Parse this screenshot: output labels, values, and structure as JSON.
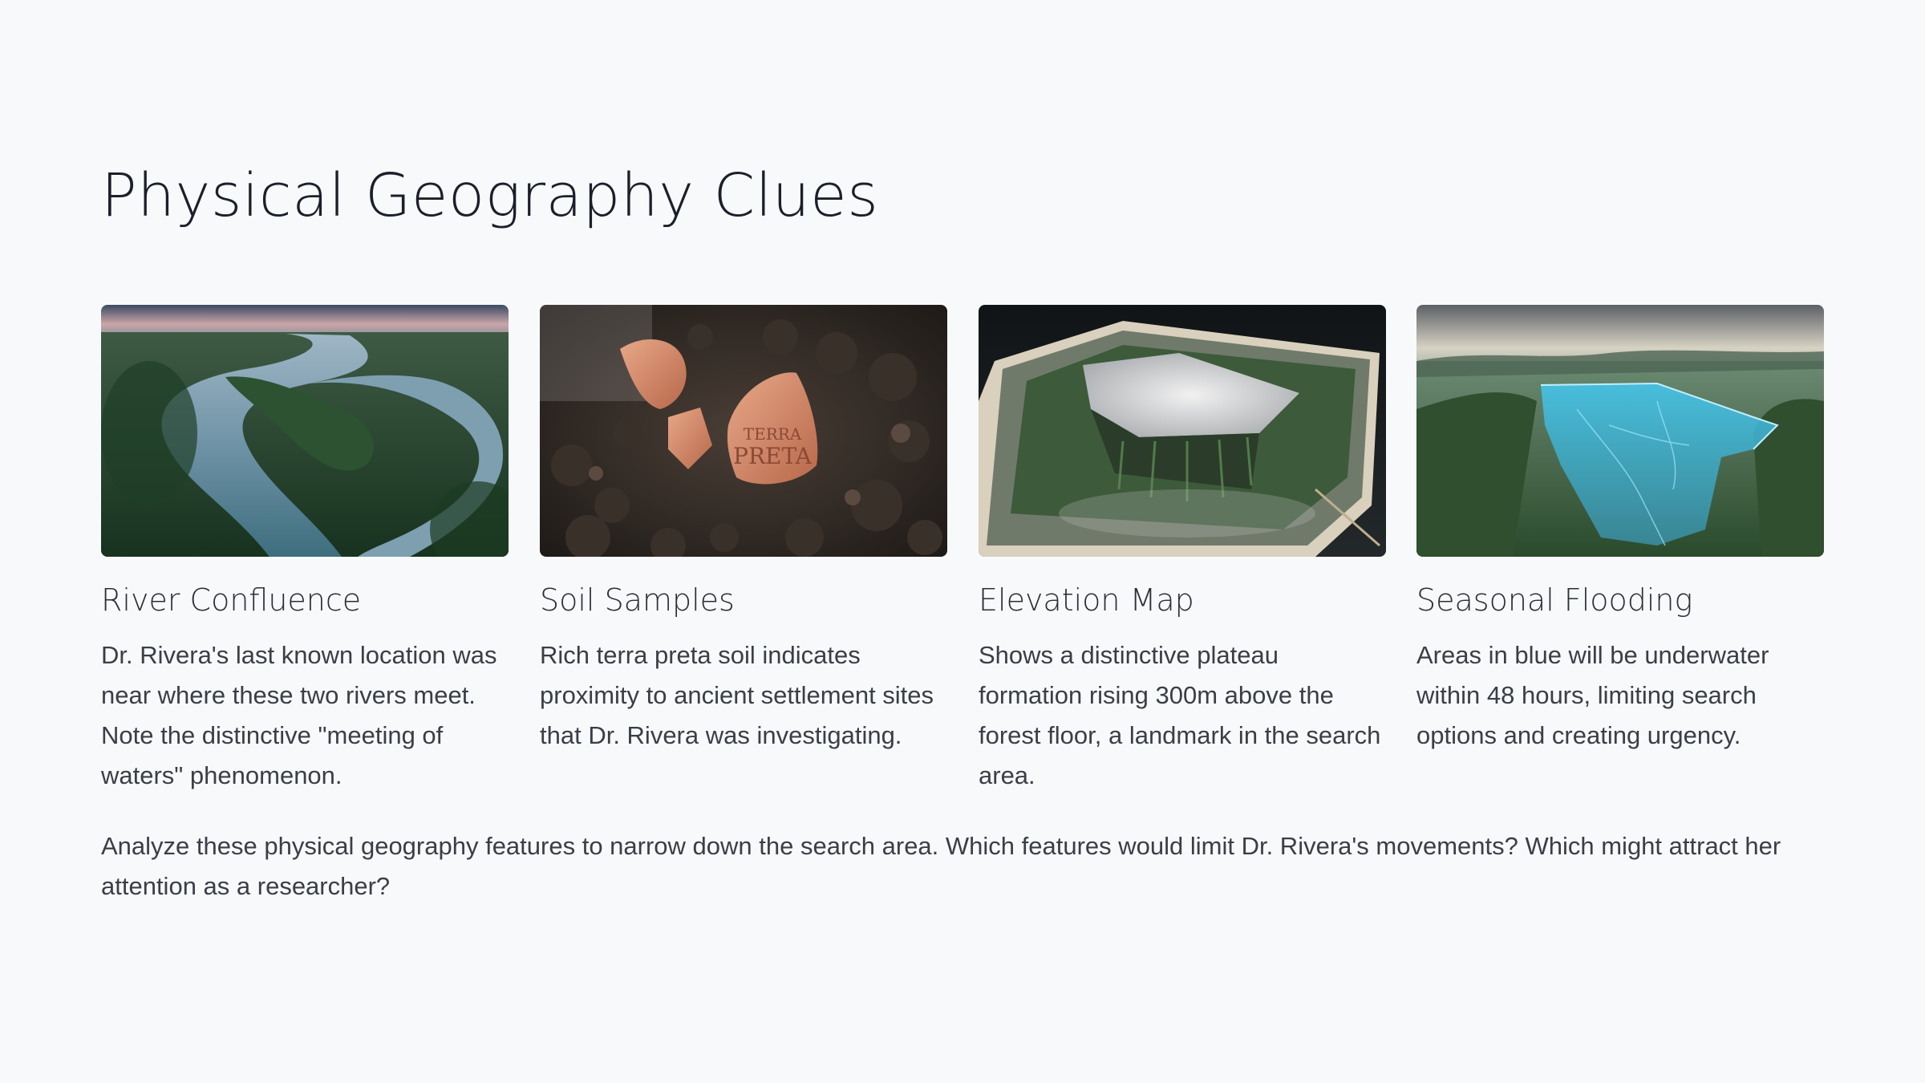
{
  "slide": {
    "title": "Physical Geography Clues",
    "footer": "Analyze these physical geography features to narrow down the search area. Which features would limit Dr. Rivera's movements? Which might attract her attention as a researcher?"
  },
  "cards": [
    {
      "title": "River Confluence",
      "text": "Dr. Rivera's last known location was near where these two rivers meet. Note the distinctive \"meeting of waters\" phenomenon.",
      "image_icon": "river-aerial-image"
    },
    {
      "title": "Soil Samples",
      "text": "Rich terra preta soil indicates proximity to ancient settlement sites that Dr. Rivera was investigating.",
      "image_icon": "soil-pottery-image",
      "image_label_line1": "TERRA",
      "image_label_line2": "PRETA"
    },
    {
      "title": "Elevation Map",
      "text": "Shows a distinctive plateau formation rising 300m above the forest floor, a landmark in the search area.",
      "image_icon": "plateau-relief-map-image"
    },
    {
      "title": "Seasonal Flooding",
      "text": "Areas in blue will be underwater within 48 hours, limiting search options and creating urgency.",
      "image_icon": "flood-valley-image"
    }
  ],
  "colors": {
    "background": "#f8f9fb",
    "title": "#1b1f2a",
    "body_text": "#3a3e46",
    "flood_blue": "#3fc3ec"
  }
}
